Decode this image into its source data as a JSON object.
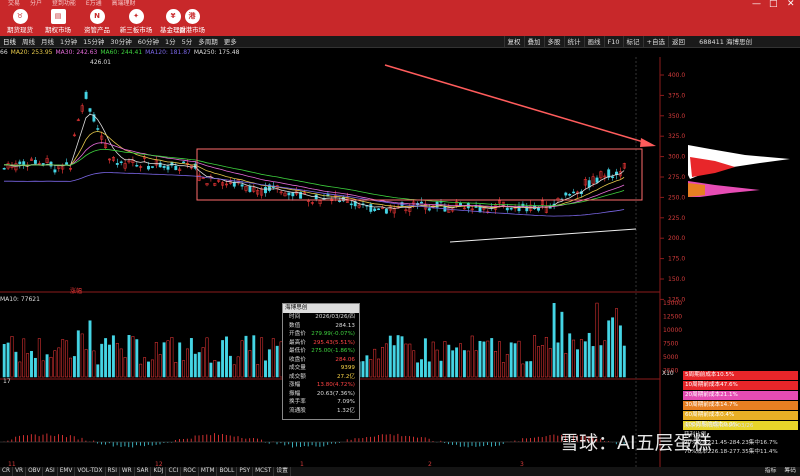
{
  "window": {
    "menu": [
      "交易",
      "分户",
      "登到功能",
      "E万通",
      "高端理财"
    ],
    "controls": [
      "—",
      "□",
      "✕"
    ]
  },
  "toolbar": [
    {
      "label": "期货现货",
      "icon": "bull-icon"
    },
    {
      "label": "期权市场",
      "icon": "chart-icon"
    },
    {
      "label": "资管产品",
      "icon": "news-icon"
    },
    {
      "label": "新三板市场",
      "icon": "star-icon"
    },
    {
      "label": "基金理财",
      "icon": "money-icon"
    },
    {
      "label": "香港市场",
      "icon": "hk-icon",
      "glyph": "港"
    }
  ],
  "periods": [
    "日线",
    "周线",
    "月线",
    "1分钟",
    "15分钟",
    "30分钟",
    "60分钟",
    "1分",
    "5分",
    "多周期",
    "更多"
  ],
  "period_right": [
    "复权",
    "叠加",
    "多股",
    "统计",
    "画线",
    "F10",
    "标记",
    "+自选",
    "返回"
  ],
  "stock": {
    "code": "688411",
    "name": "海博思创"
  },
  "ma": [
    {
      "text": "66",
      "color": "#dddddd"
    },
    {
      "text": "MA20: 253.95",
      "color": "#e5c84a"
    },
    {
      "text": "MA30: 242.63",
      "color": "#e56bd9"
    },
    {
      "text": "MA60: 244.41",
      "color": "#3ed13e"
    },
    {
      "text": "MA120: 181.87",
      "color": "#7a66e6"
    },
    {
      "text": "MA250: 175.48",
      "color": "#dddddd"
    }
  ],
  "price_axis": [
    "400.0",
    "375.0",
    "350.0",
    "325.0",
    "300.0",
    "275.0",
    "250.0",
    "225.0",
    "200.0",
    "175.0",
    "150.0",
    "125.0"
  ],
  "vol_axis": [
    "15000",
    "12500",
    "10000",
    "7500",
    "5000",
    "2500"
  ],
  "high_label": "426.01",
  "ma10_label": "MA10: 77621",
  "marker_labels": [
    "涨幅",
    "17",
    "X10"
  ],
  "tooltip": {
    "title": "海博思创",
    "rows": [
      {
        "k": "时间",
        "v": "2026/03/26/四",
        "c": "#dddddd"
      },
      {
        "k": "数值",
        "v": "284.13",
        "c": "#dddddd"
      },
      {
        "k": "开盘价",
        "v": "279.99(-0.07%)",
        "c": "#3ed13e"
      },
      {
        "k": "最高价",
        "v": "295.43(5.51%)",
        "c": "#ff4444"
      },
      {
        "k": "最低价",
        "v": "275.00(-1.86%)",
        "c": "#3ed13e"
      },
      {
        "k": "收盘价",
        "v": "284.06",
        "c": "#ff4444"
      },
      {
        "k": "成交量",
        "v": "9399",
        "c": "#ffd84a"
      },
      {
        "k": "成交额",
        "v": "27.2亿",
        "c": "#ffd84a"
      },
      {
        "k": "涨幅",
        "v": "13.80(4.72%)",
        "c": "#ff4444"
      },
      {
        "k": "振幅",
        "v": "20.63(7.36%)",
        "c": "#dddddd"
      },
      {
        "k": "换手率",
        "v": "7.09%",
        "c": "#dddddd"
      },
      {
        "k": "流通股",
        "v": "1.32亿",
        "c": "#dddddd"
      }
    ]
  },
  "cost_legend": [
    {
      "text": "5周期前成本10.5%",
      "bg": "#e8262a"
    },
    {
      "text": "10周期前成本47.6%",
      "bg": "#e8262a"
    },
    {
      "text": "20周期前成本21.1%",
      "bg": "#e64cb4"
    },
    {
      "text": "30周期前成本14.7%",
      "bg": "#e77f22"
    },
    {
      "text": "60周期前成本0.4%",
      "bg": "#e9b026"
    },
    {
      "text": "100周期前成本0.0%",
      "bg": "#e8d52a"
    }
  ],
  "cost_info": [
    "成本分布,日期:2026/03/26",
    "获利比例",
    "90%成本221.45-284.23集中16.7%",
    "70%成本226.18-277.35集中11.4%"
  ],
  "watermark": "雪球：AI五层蛋糕",
  "ind_tabs": [
    "CR",
    "VR",
    "OBV",
    "ASI",
    "EMV",
    "VOL-TDX",
    "RSI",
    "WR",
    "SAR",
    "KDJ",
    "CCI",
    "ROC",
    "MTM",
    "BOLL",
    "PSY",
    "MCST",
    "设置"
  ],
  "right_tabs": [
    "指标",
    "筹码"
  ],
  "date_markers": [
    "11",
    "12",
    "1",
    "2",
    "3"
  ]
}
